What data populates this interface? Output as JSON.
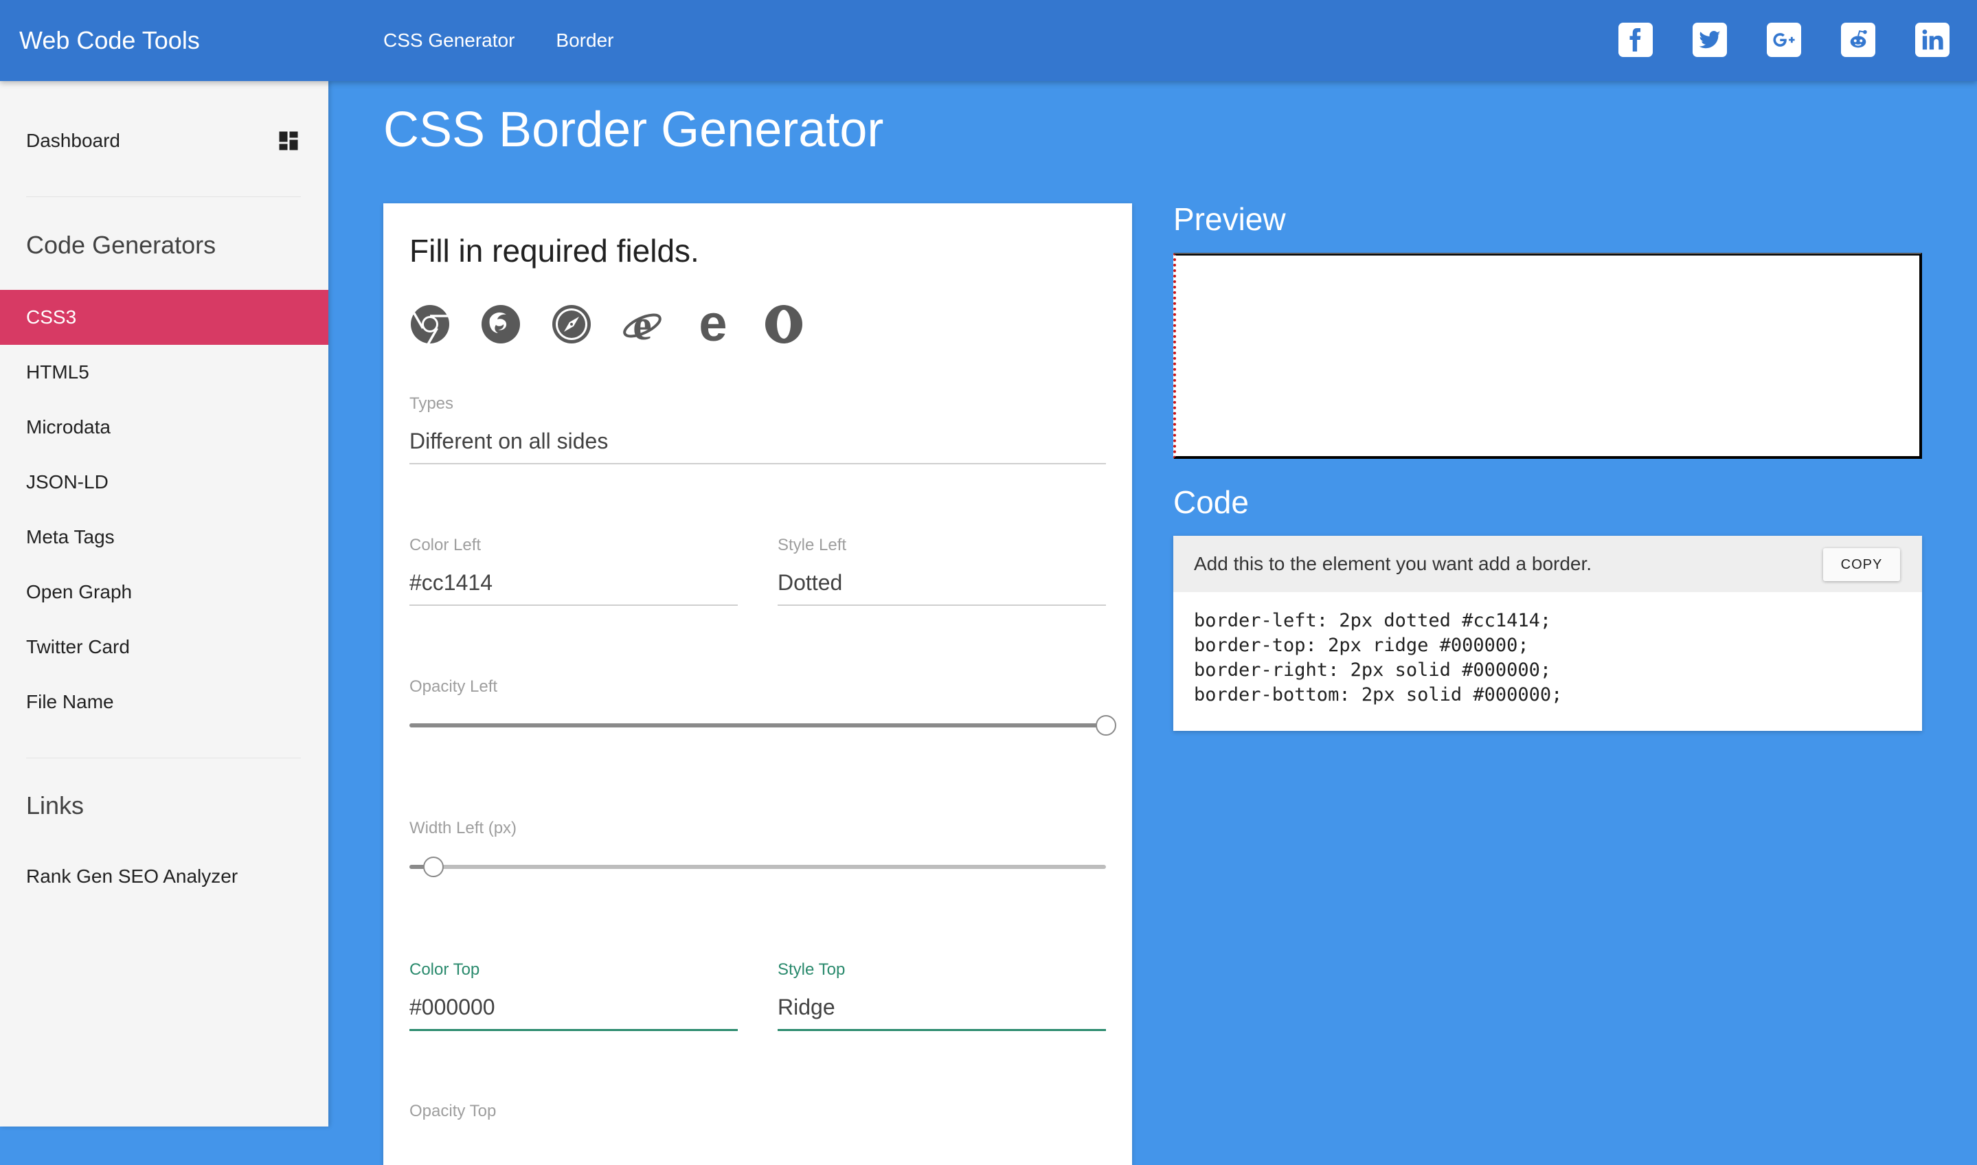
{
  "header": {
    "brand": "Web Code Tools",
    "nav": [
      "CSS Generator",
      "Border"
    ],
    "social": [
      "facebook-icon",
      "twitter-icon",
      "google-plus-icon",
      "reddit-icon",
      "linkedin-icon"
    ],
    "bar_color": "#3477cf"
  },
  "sidebar": {
    "dashboard": "Dashboard",
    "code_generators_heading": "Code Generators",
    "items": [
      {
        "label": "CSS3",
        "active": true
      },
      {
        "label": "HTML5"
      },
      {
        "label": "Microdata"
      },
      {
        "label": "JSON-LD"
      },
      {
        "label": "Meta Tags"
      },
      {
        "label": "Open Graph"
      },
      {
        "label": "Twitter Card"
      },
      {
        "label": "File Name"
      }
    ],
    "links_heading": "Links",
    "links": [
      "Rank Gen SEO Analyzer"
    ],
    "active_color": "#d73a64"
  },
  "main": {
    "title": "CSS Border Generator",
    "form": {
      "heading": "Fill in required fields.",
      "browsers": [
        "chrome-icon",
        "firefox-icon",
        "safari-icon",
        "internet-explorer-icon",
        "edge-icon",
        "opera-icon"
      ],
      "types": {
        "label": "Types",
        "value": "Different on all sides"
      },
      "color_left": {
        "label": "Color Left",
        "value": "#cc1414"
      },
      "style_left": {
        "label": "Style Left",
        "value": "Dotted"
      },
      "opacity_left": {
        "label": "Opacity Left",
        "value": 1.0
      },
      "width_left": {
        "label": "Width Left (px)",
        "value": 2,
        "fraction": 0.035
      },
      "color_top": {
        "label": "Color Top",
        "value": "#000000"
      },
      "style_top": {
        "label": "Style Top",
        "value": "Ridge"
      },
      "opacity_top": {
        "label": "Opacity Top"
      }
    },
    "preview_title": "Preview",
    "code_title": "Code",
    "code": {
      "message": "Add this to the element you want add a border.",
      "copy_label": "COPY",
      "lines": [
        "border-left: 2px dotted #cc1414;",
        "border-top: 2px ridge #000000;",
        "border-right: 2px solid #000000;",
        "border-bottom: 2px solid #000000;"
      ]
    },
    "focus_color": "#2a8a6d",
    "background_color": "#4495ea"
  }
}
